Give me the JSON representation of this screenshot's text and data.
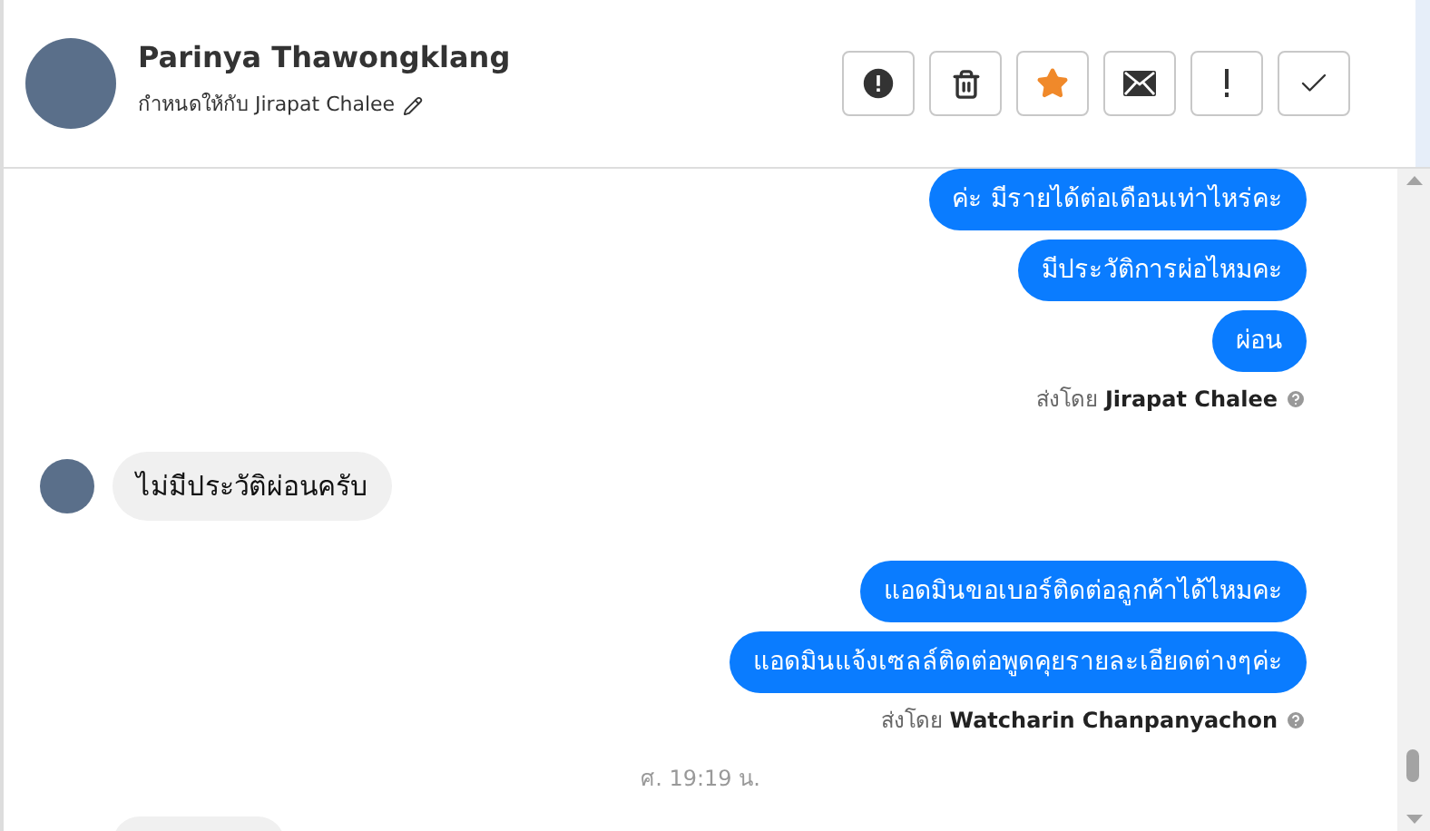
{
  "header": {
    "name": "Parinya Thawongklang",
    "assigned_label": "กำหนดให้กับ Jirapat Chalee"
  },
  "actions": [
    {
      "kind": "alert",
      "on": false
    },
    {
      "kind": "delete",
      "on": false
    },
    {
      "kind": "star",
      "on": true
    },
    {
      "kind": "mail",
      "on": false
    },
    {
      "kind": "important",
      "on": false
    },
    {
      "kind": "done",
      "on": false
    }
  ],
  "thread": [
    {
      "kind": "outgoing",
      "bubbles": [
        "ค่ะ มีรายได้ต่อเดือนเท่าไหร่คะ",
        "มีประวัติการผ่อไหมคะ",
        "ผ่อน"
      ],
      "sent_by_label": "ส่งโดย",
      "sender": "Jirapat Chalee"
    },
    {
      "kind": "incoming",
      "bubbles": [
        "ไม่มีประวัติผ่อนครับ"
      ]
    },
    {
      "kind": "outgoing",
      "bubbles": [
        "แอดมินขอเบอร์ติดต่อลูกค้าได้ไหมคะ",
        "แอดมินแจ้งเซลล์ติดต่อพูดคุยรายละเอียดต่างๆค่ะ"
      ],
      "sent_by_label": "ส่งโดย",
      "sender": "Watcharin Chanpanyachon"
    },
    {
      "kind": "time",
      "text": "ศ. 19:19 น."
    },
    {
      "kind": "incoming_partial"
    }
  ]
}
